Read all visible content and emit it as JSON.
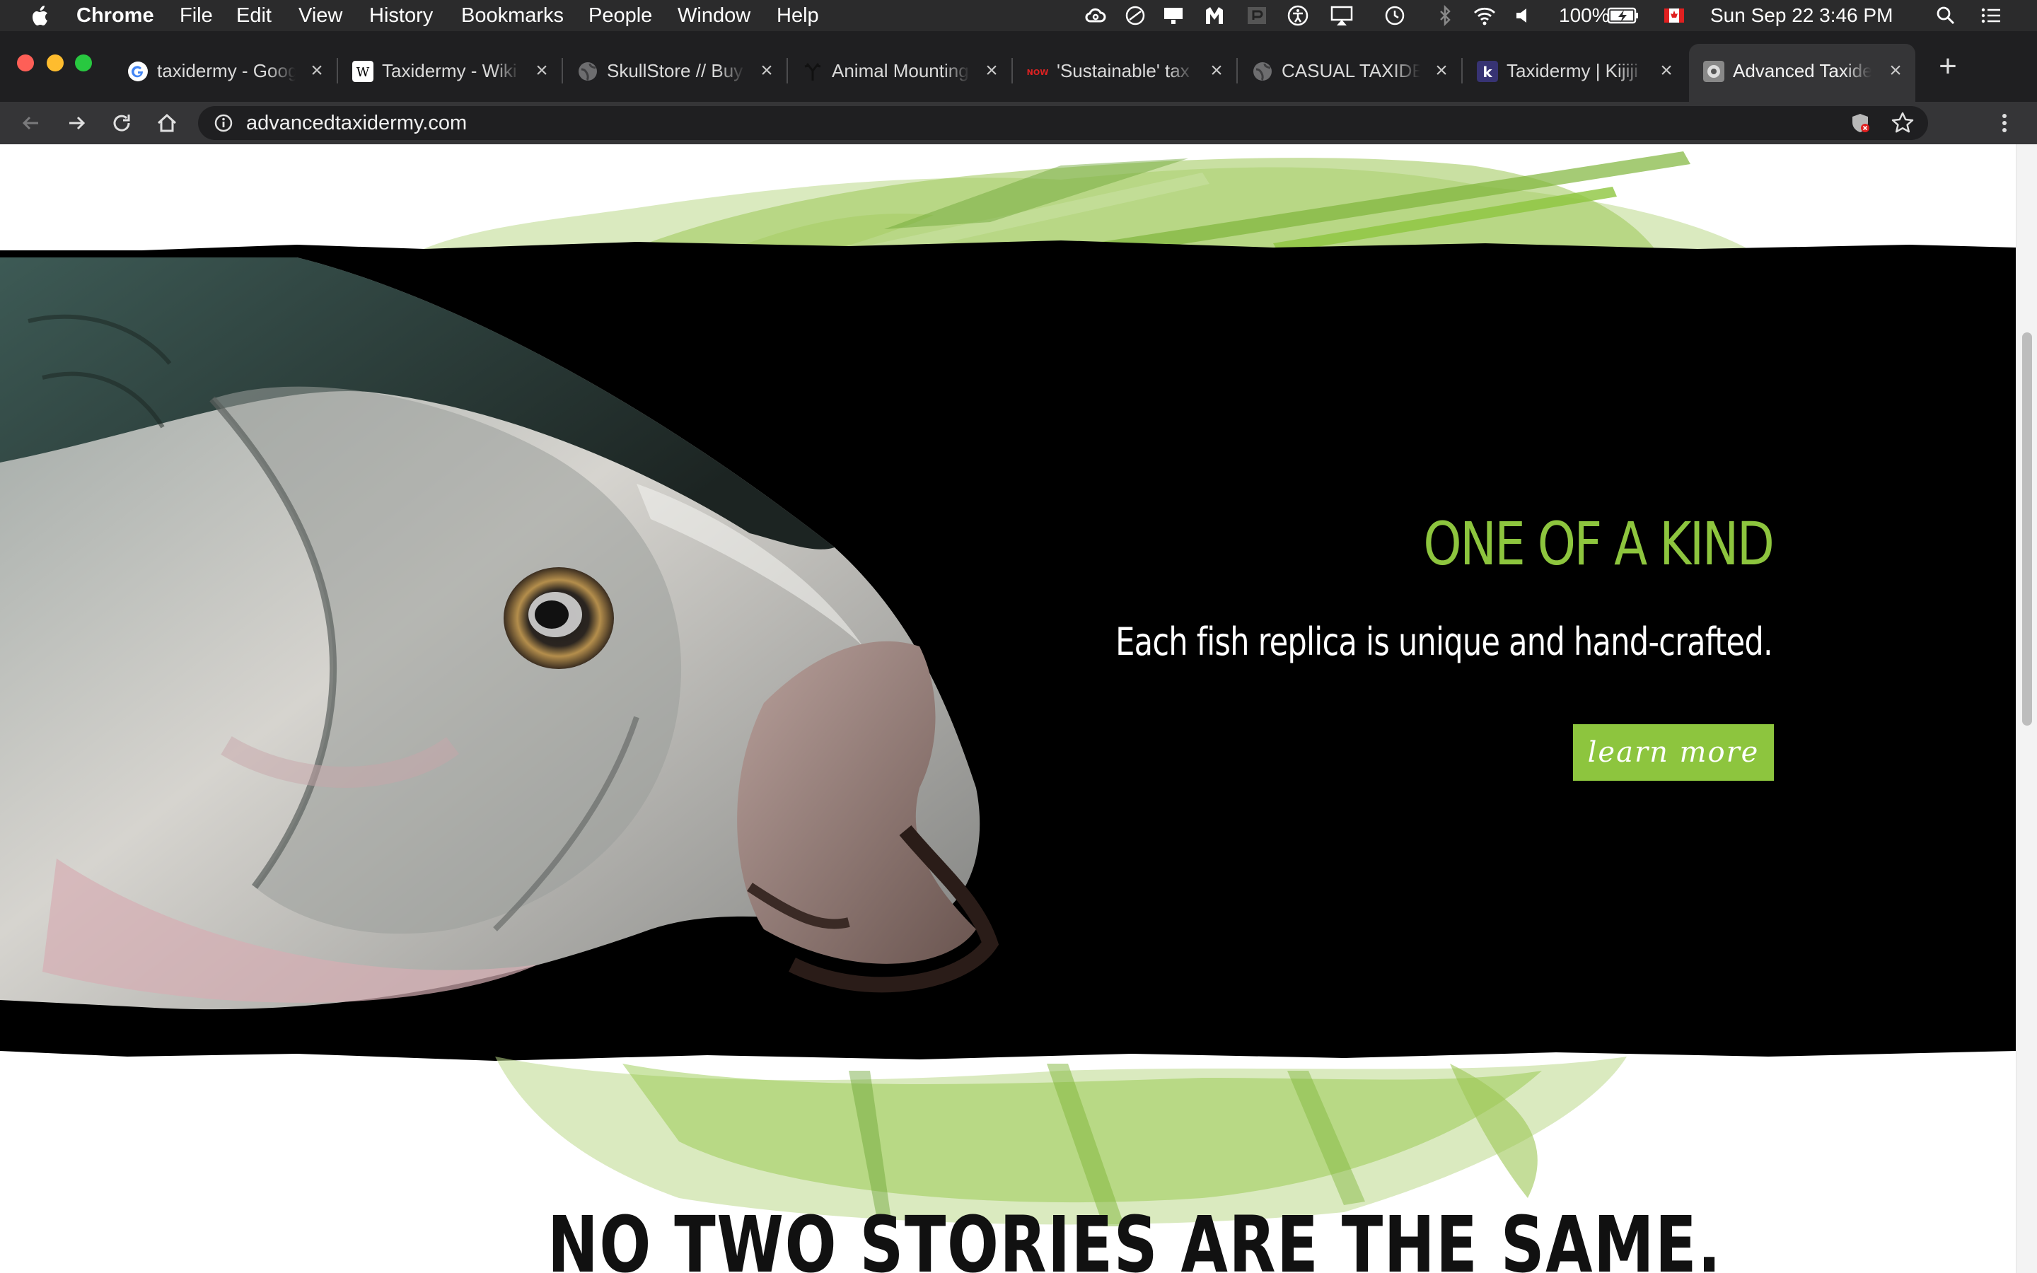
{
  "menubar": {
    "app": "Chrome",
    "items": [
      "File",
      "Edit",
      "View",
      "History",
      "Bookmarks",
      "People",
      "Window",
      "Help"
    ],
    "battery": "100%",
    "datetime": "Sun Sep 22  3:46 PM",
    "icons": [
      "creative-cloud-icon",
      "sync-icon",
      "display-icon",
      "malwarebytes-icon",
      "pen-icon",
      "accessibility-icon",
      "airplay-icon",
      "time-machine-icon",
      "bluetooth-icon",
      "wifi-icon",
      "volume-icon",
      "battery-icon",
      "flag-canada-icon",
      "spotlight-icon",
      "notification-list-icon"
    ]
  },
  "tabs": [
    {
      "title": "taxidermy - Goog",
      "favicon": "google-icon"
    },
    {
      "title": "Taxidermy - Wiki",
      "favicon": "wikipedia-icon"
    },
    {
      "title": "SkullStore // Buy",
      "favicon": "globe-icon"
    },
    {
      "title": "Animal Mounting",
      "favicon": "antler-icon"
    },
    {
      "title": "'Sustainable' tax",
      "favicon": "now-icon"
    },
    {
      "title": "CASUAL TAXIDE",
      "favicon": "globe-icon"
    },
    {
      "title": "Taxidermy | Kijiji",
      "favicon": "kijiji-icon"
    },
    {
      "title": "Advanced Taxide",
      "favicon": "site-icon",
      "active": true
    }
  ],
  "toolbar": {
    "url": "advancedtaxidermy.com"
  },
  "colors": {
    "accent_green": "#8dc53e",
    "hero_background": "#000000",
    "chrome_dark": "#1f1f21"
  },
  "hero": {
    "heading": "ONE OF A KIND",
    "subheading": "Each fish replica is unique and hand-crafted.",
    "cta": "learn more"
  },
  "section": {
    "heading": "NO TWO STORIES ARE THE SAME."
  }
}
